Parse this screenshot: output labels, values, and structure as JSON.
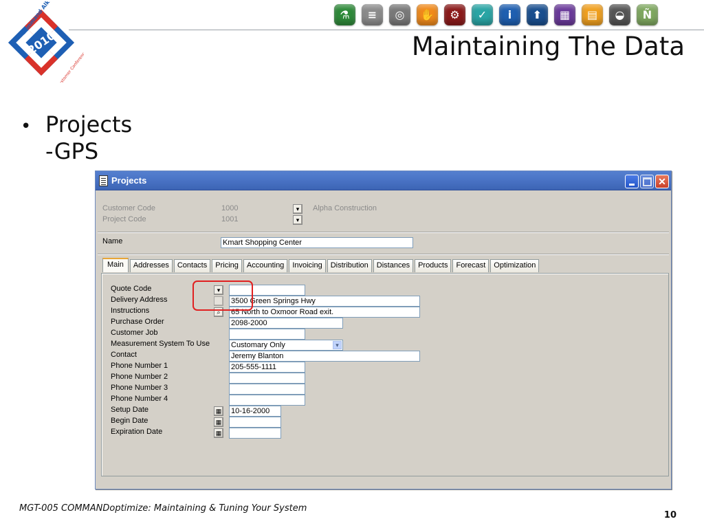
{
  "slide": {
    "title": "Maintaining The Data",
    "bullet": "Projects",
    "sub_bullet": "-GPS",
    "footer": "MGT-005 COMMANDoptimize: Maintaining & Tuning Your System",
    "page_number": "10",
    "logo": {
      "top_text": "Command Alkon",
      "year": "2010",
      "bottom_text": "Customer Conference"
    },
    "icons": [
      {
        "name": "flask-icon",
        "color": "#2f8a3a",
        "glyph": "⚗"
      },
      {
        "name": "layers-icon",
        "color": "#8c8c8c",
        "glyph": "≡"
      },
      {
        "name": "globe-icon",
        "color": "#7a7a7a",
        "glyph": "◎"
      },
      {
        "name": "hand-icon",
        "color": "#f08a1c",
        "glyph": "✋"
      },
      {
        "name": "gears-icon",
        "color": "#8b1a1a",
        "glyph": "⚙"
      },
      {
        "name": "check-icon",
        "color": "#2aa5a5",
        "glyph": "✓"
      },
      {
        "name": "info-icon",
        "color": "#1f5fb0",
        "glyph": "i"
      },
      {
        "name": "upload-icon",
        "color": "#1a4f8f",
        "glyph": "⬆"
      },
      {
        "name": "grid-icon",
        "color": "#6a3a9a",
        "glyph": "▦"
      },
      {
        "name": "folder-icon",
        "color": "#f0a020",
        "glyph": "▤"
      },
      {
        "name": "truck-icon",
        "color": "#555555",
        "glyph": "◒"
      },
      {
        "name": "n-icon",
        "color": "#7fa860",
        "glyph": "Ñ"
      }
    ]
  },
  "window": {
    "title": "Projects",
    "header": {
      "customer_code_label": "Customer Code",
      "customer_code_value": "1000",
      "customer_name": "Alpha Construction",
      "project_code_label": "Project Code",
      "project_code_value": "1001"
    },
    "name_label": "Name",
    "name_value": "Kmart Shopping Center",
    "tabs": [
      "Main",
      "Addresses",
      "Contacts",
      "Pricing",
      "Accounting",
      "Invoicing",
      "Distribution",
      "Distances",
      "Products",
      "Forecast",
      "Optimization"
    ],
    "form": {
      "quote_code_label": "Quote Code",
      "quote_code_value": "",
      "delivery_address_label": "Delivery Address",
      "delivery_address_value": "3500 Green Springs Hwy",
      "instructions_label": "Instructions",
      "instructions_value": "65 North to Oxmoor Road exit.",
      "purchase_order_label": "Purchase Order",
      "purchase_order_value": "2098-2000",
      "customer_job_label": "Customer Job",
      "customer_job_value": "",
      "measurement_label": "Measurement System To Use",
      "measurement_value": "Customary Only",
      "contact_label": "Contact",
      "contact_value": "Jeremy Blanton",
      "phone1_label": "Phone Number 1",
      "phone1_value": "205-555-1111",
      "phone2_label": "Phone Number 2",
      "phone2_value": "",
      "phone3_label": "Phone Number 3",
      "phone3_value": "",
      "phone4_label": "Phone Number 4",
      "phone4_value": "",
      "setup_date_label": "Setup Date",
      "setup_date_value": "10-16-2000",
      "begin_date_label": "Begin Date",
      "begin_date_value": "",
      "expiration_date_label": "Expiration Date",
      "expiration_date_value": ""
    }
  }
}
